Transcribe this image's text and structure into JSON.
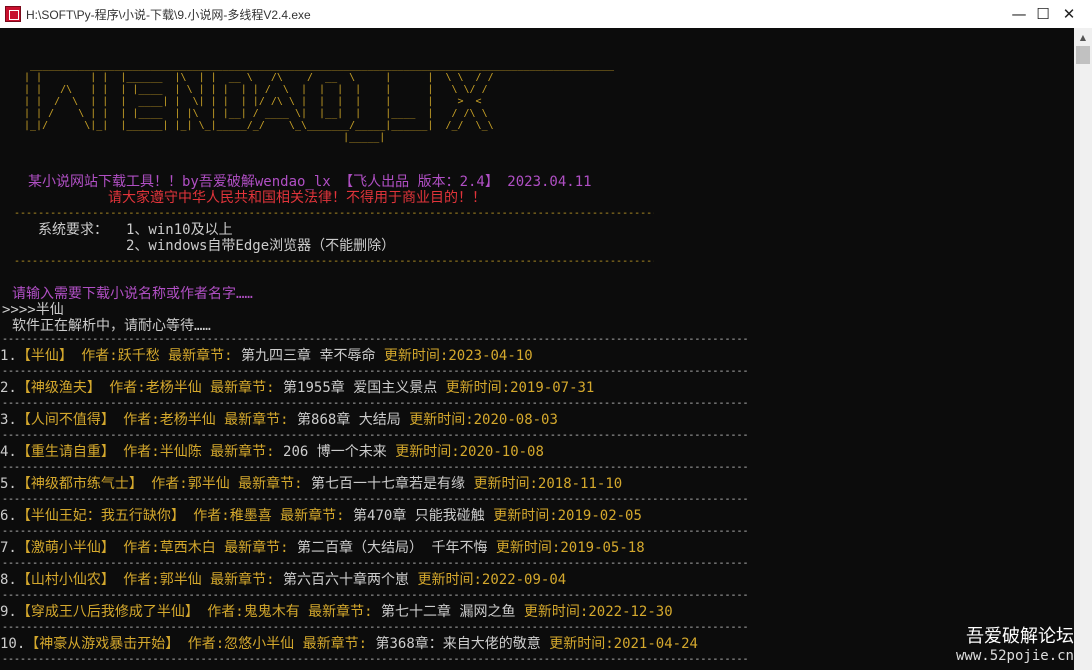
{
  "window": {
    "title": "H:\\SOFT\\Py-程序\\小说-下载\\9.小说网-多线程V2.4.exe",
    "minimize": "—",
    "maximize": "☐",
    "close": "✕"
  },
  "banner": {
    "ascii": [
      "  _________________________________________________________________________________________________",
      " | |        | |  |______  |\\  | |  __ \\   /\\    /  __  \\     |      |  \\ \\  / /",
      " | |   /\\   | |  | |____  | \\ | | |  | | /  \\  |  |  |  |    |      |   \\ \\/ /",
      " | |  /  \\  | |  |  ____| |  \\| | |  | |/ /\\ \\ |  |  |  |    |      |    >  <",
      " | | /    \\ | |  | |____  | |\\  | |__| / ____ \\|  |__|  |    |____  |   / /\\ \\",
      " |_|/      \\|_|  |______| |_| \\_|_____/_/    \\_\\_______/_____|______|  /_/  \\_\\",
      "                                                      |_____|"
    ]
  },
  "header": {
    "tool_line": "某小说网站下载工具！！by吾爱破解wendao_lx 【飞人出品 版本：2.4】 2023.04.11",
    "law_line": "请大家遵守中华人民共和国相关法律！不得用于商业目的！！",
    "sys_label": "系统要求：",
    "req1": "1、win10及以上",
    "req2": "2、windows自带Edge浏览器（不能删除）"
  },
  "prompt": {
    "ask": "请输入需要下载小说名称或作者名字……",
    "input": ">>>>半仙",
    "parsing": "软件正在解析中，请耐心等待……"
  },
  "results": [
    {
      "idx": "1.",
      "title": "【半仙】",
      "author": "作者:跃千愁",
      "latest_label": "最新章节:",
      "chapter": "第九四三章 幸不辱命",
      "time": "更新时间:2023-04-10"
    },
    {
      "idx": "2.",
      "title": "【神级渔夫】",
      "author": "作者:老杨半仙",
      "latest_label": "最新章节:",
      "chapter": "第1955章 爱国主义景点",
      "time": "更新时间:2019-07-31"
    },
    {
      "idx": "3.",
      "title": "【人间不值得】",
      "author": "作者:老杨半仙",
      "latest_label": "最新章节:",
      "chapter": "第868章 大结局",
      "time": "更新时间:2020-08-03"
    },
    {
      "idx": "4.",
      "title": "【重生请自重】",
      "author": "作者:半仙陈",
      "latest_label": "最新章节:",
      "chapter": "206 博一个未来",
      "time": "更新时间:2020-10-08"
    },
    {
      "idx": "5.",
      "title": "【神级都市练气士】",
      "author": "作者:郭半仙",
      "latest_label": "最新章节:",
      "chapter": "第七百一十七章若是有缘",
      "time": "更新时间:2018-11-10"
    },
    {
      "idx": "6.",
      "title": "【半仙王妃：我五行缺你】",
      "author": "作者:稚墨喜",
      "latest_label": "最新章节:",
      "chapter": "第470章 只能我碰触",
      "time": "更新时间:2019-02-05"
    },
    {
      "idx": "7.",
      "title": "【激萌小半仙】",
      "author": "作者:草西木白",
      "latest_label": "最新章节:",
      "chapter": "第二百章（大结局） 千年不悔",
      "time": "更新时间:2019-05-18"
    },
    {
      "idx": "8.",
      "title": "【山村小仙农】",
      "author": "作者:郭半仙",
      "latest_label": "最新章节:",
      "chapter": "第六百六十章两个崽",
      "time": "更新时间:2022-09-04"
    },
    {
      "idx": "9.",
      "title": "【穿成王八后我修成了半仙】",
      "author": "作者:鬼鬼木有",
      "latest_label": "最新章节:",
      "chapter": "第七十二章 漏网之鱼",
      "time": "更新时间:2022-12-30"
    },
    {
      "idx": "10.",
      "title": "【神豪从游戏暴击开始】",
      "author": "作者:忽悠小半仙",
      "latest_label": "最新章节:",
      "chapter": "第368章：来自大佬的敬意",
      "time": "更新时间:2021-04-24"
    }
  ],
  "watermark": {
    "name": "吾爱破解论坛",
    "url": "www.52pojie.cn"
  },
  "colors": {
    "console_bg": "#0c0c0c",
    "gold": "#d4a82d",
    "purple": "#b04fc4",
    "red": "#e0343a",
    "text": "#cccccc"
  }
}
